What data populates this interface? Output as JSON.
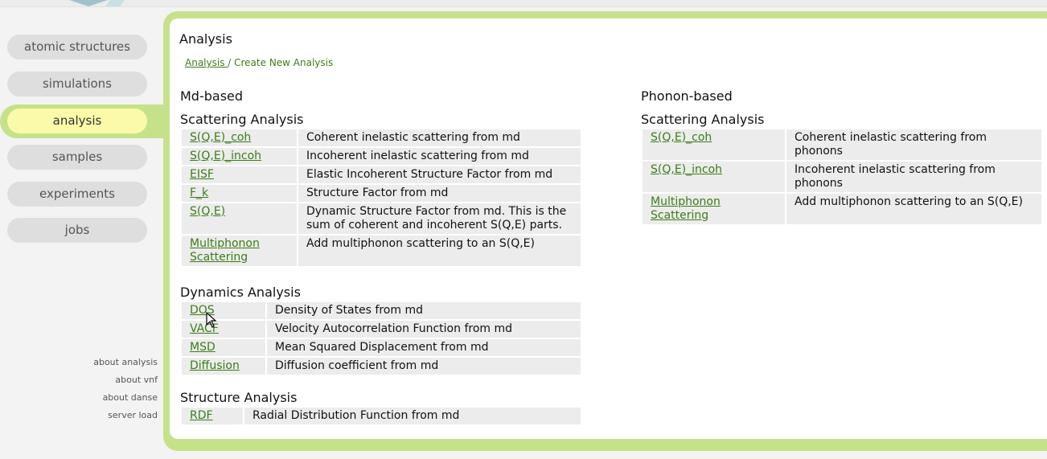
{
  "nav": {
    "items": [
      {
        "label": "atomic structures"
      },
      {
        "label": "simulations"
      },
      {
        "label": "analysis"
      },
      {
        "label": "samples"
      },
      {
        "label": "experiments"
      },
      {
        "label": "jobs"
      }
    ],
    "active_index": 2,
    "footer_links": [
      "about analysis",
      "about vnf",
      "about danse",
      "server load"
    ]
  },
  "page": {
    "title": "Analysis",
    "breadcrumb": {
      "root": "Analysis ",
      "sep": "/",
      "current": " Create New Analysis"
    }
  },
  "md": {
    "heading": "Md-based",
    "scattering": {
      "heading": "Scattering Analysis",
      "rows": [
        {
          "k": "S(Q,E)_coh",
          "v": "Coherent inelastic scattering from md"
        },
        {
          "k": "S(Q,E)_incoh",
          "v": "Incoherent inelastic scattering from md"
        },
        {
          "k": "EISF",
          "v": "Elastic Incoherent Structure Factor from md"
        },
        {
          "k": "F_k",
          "v": "Structure Factor from md"
        },
        {
          "k": "S(Q,E)",
          "v": "Dynamic Structure Factor from md. This is the sum of coherent and incoherent S(Q,E) parts."
        },
        {
          "k": "Multiphonon Scattering",
          "v": "Add multiphonon scattering to an S(Q,E)"
        }
      ]
    },
    "dynamics": {
      "heading": "Dynamics Analysis",
      "rows": [
        {
          "k": "DOS",
          "v": "Density of States from md"
        },
        {
          "k": "VACF",
          "v": "Velocity Autocorrelation Function from md"
        },
        {
          "k": "MSD",
          "v": "Mean Squared Displacement from md"
        },
        {
          "k": "Diffusion",
          "v": "Diffusion coefficient from md"
        }
      ]
    },
    "structure": {
      "heading": "Structure Analysis",
      "rows": [
        {
          "k": "RDF",
          "v": "Radial Distribution Function from md"
        }
      ]
    }
  },
  "phonon": {
    "heading": "Phonon-based",
    "scattering": {
      "heading": "Scattering Analysis",
      "rows": [
        {
          "k": "S(Q,E)_coh",
          "v": "Coherent inelastic scattering from phonons"
        },
        {
          "k": "S(Q,E)_incoh",
          "v": "Incoherent inelastic scattering from phonons"
        },
        {
          "k": "Multiphonon Scattering",
          "v": "Add multiphonon scattering to an S(Q,E)"
        }
      ]
    }
  },
  "colors": {
    "accent": "#c5e28a",
    "active": "#fafaa8",
    "link": "#3b7d18"
  }
}
